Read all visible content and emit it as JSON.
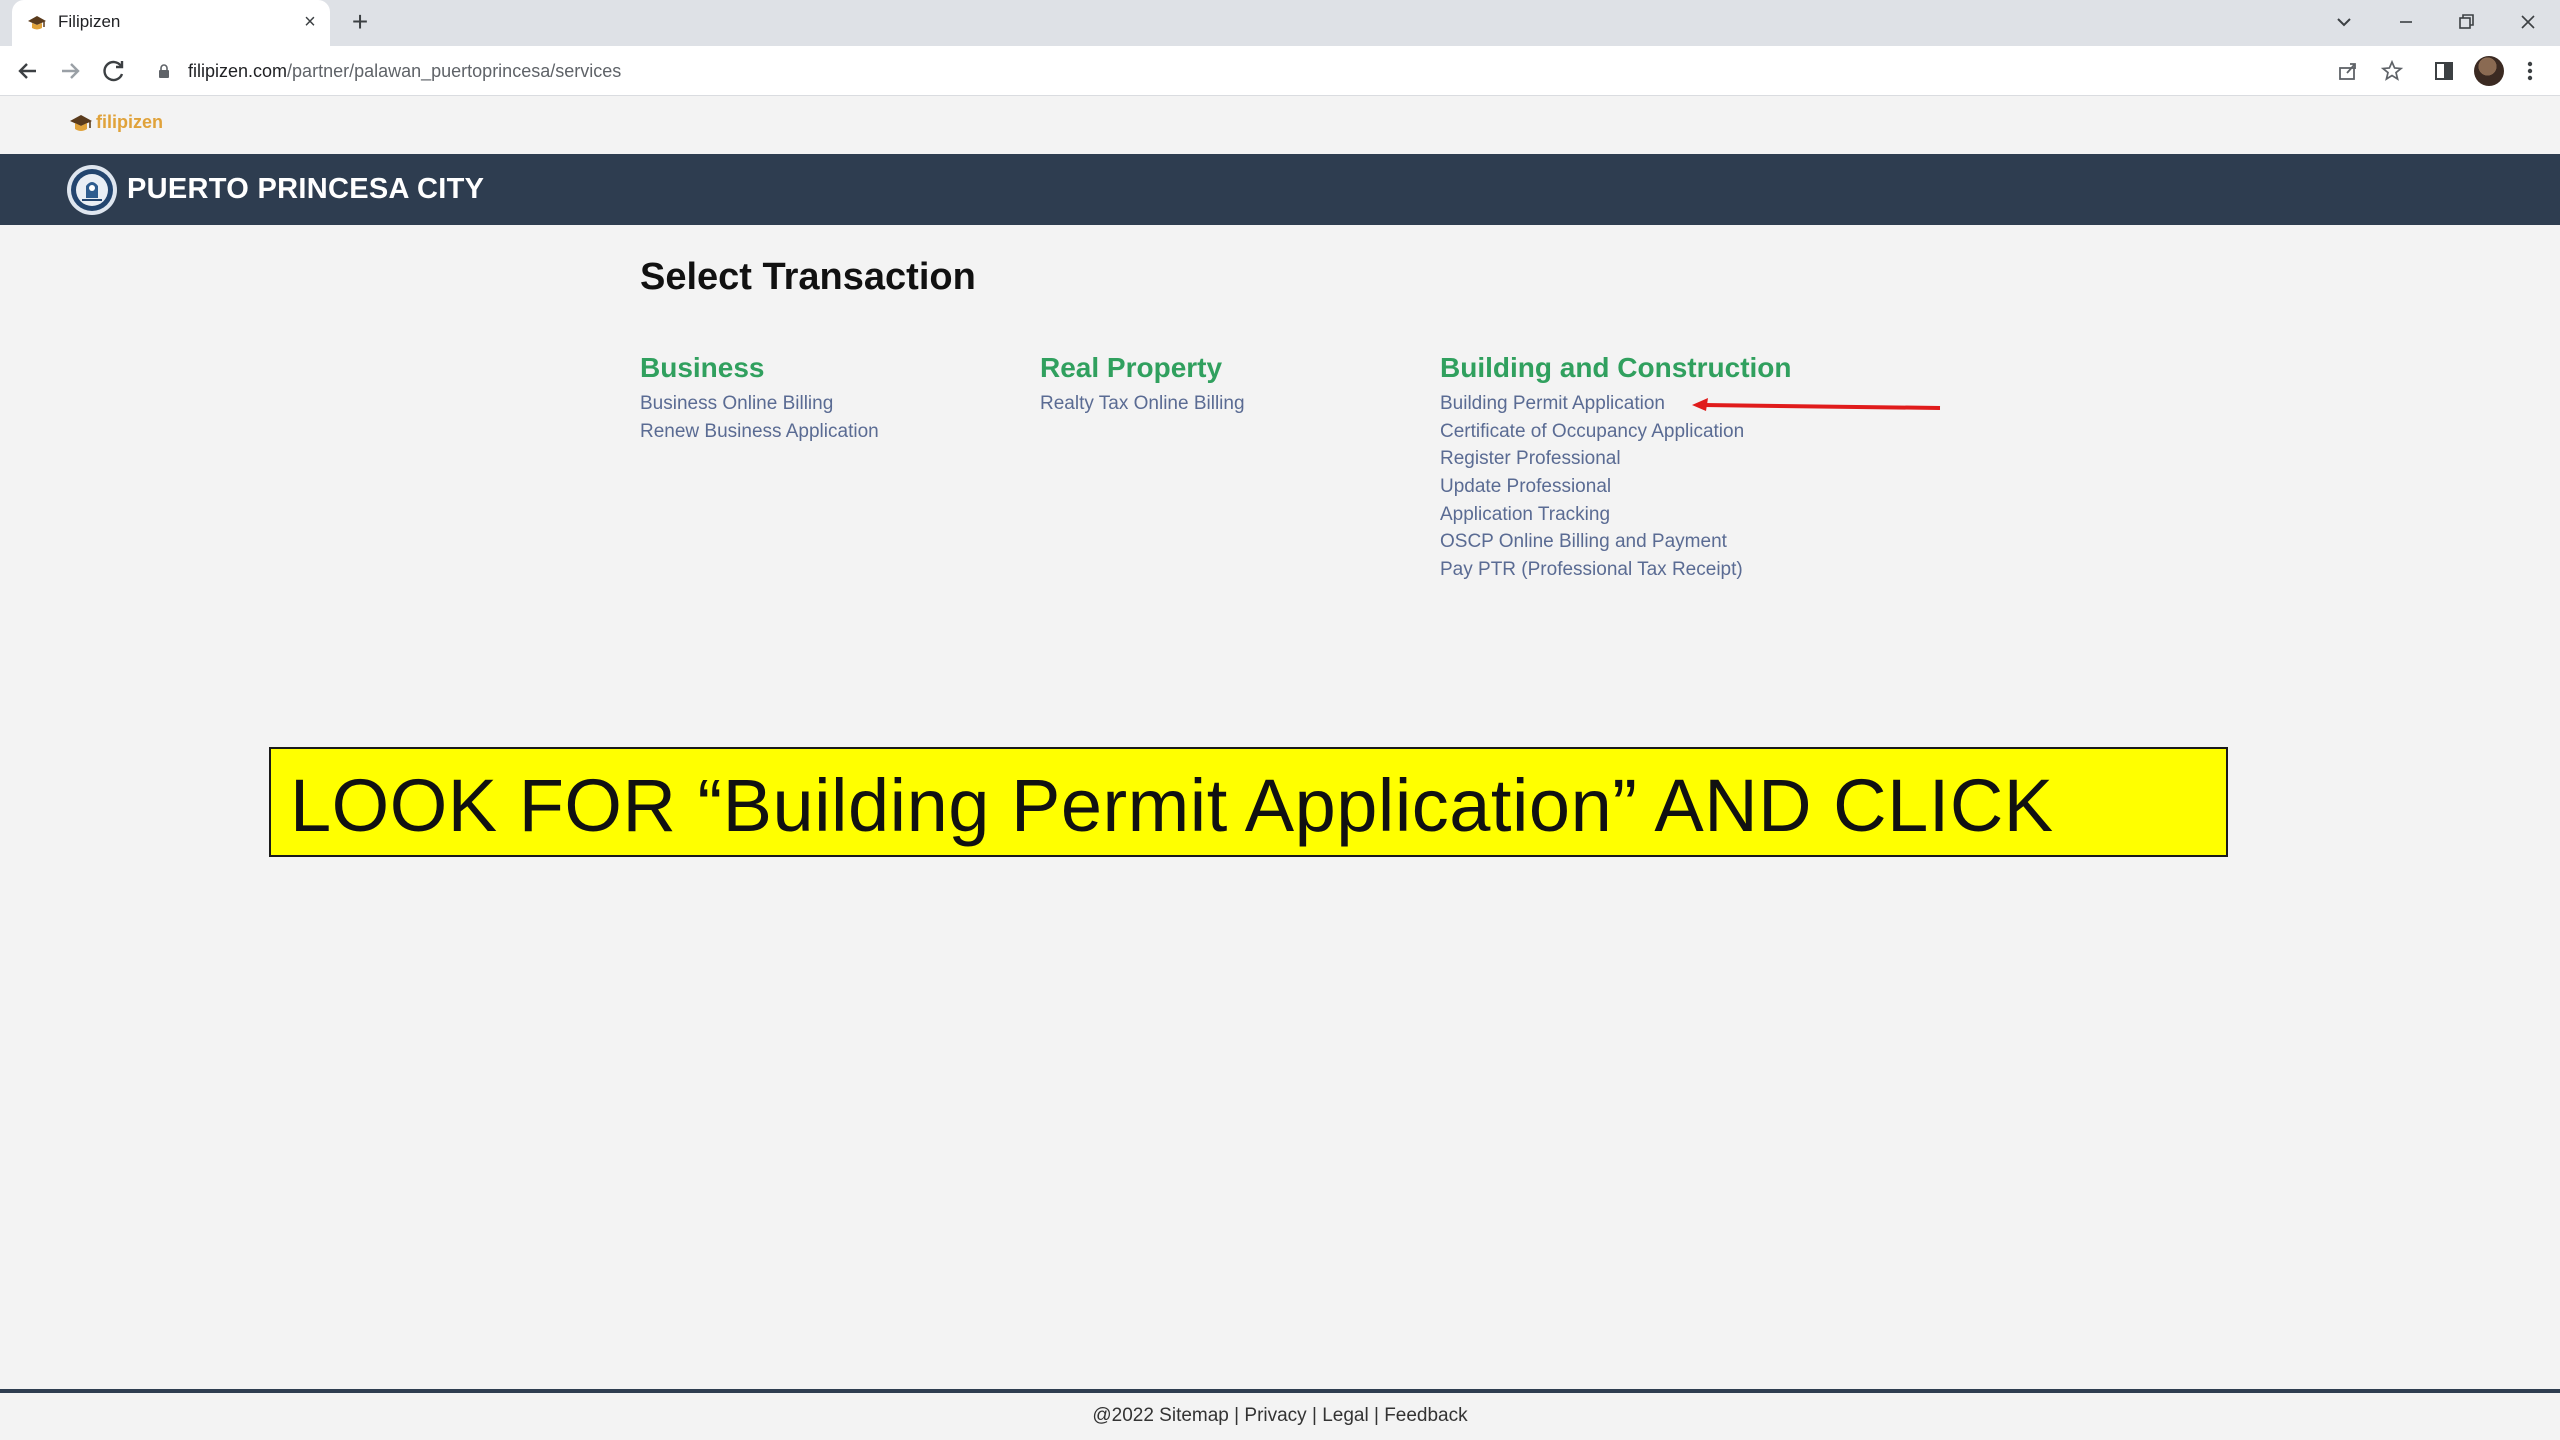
{
  "browser": {
    "tab_title": "Filipizen",
    "new_tab": "+",
    "close": "×",
    "url_host": "filipizen.com",
    "url_path": "/partner/palawan_puertoprincesa/services"
  },
  "site": {
    "brand": "filipizen",
    "city": "PUERTO PRINCESA CITY"
  },
  "main": {
    "title": "Select Transaction",
    "columns": [
      {
        "heading": "Business",
        "links": [
          "Business Online Billing",
          "Renew Business Application"
        ]
      },
      {
        "heading": "Real Property",
        "links": [
          "Realty Tax Online Billing"
        ]
      },
      {
        "heading": "Building and Construction",
        "links": [
          "Building Permit Application",
          "Certificate of Occupancy Application",
          "Register Professional",
          "Update Professional",
          "Application Tracking",
          "OSCP Online Billing and Payment",
          "Pay PTR (Professional Tax Receipt)"
        ]
      }
    ]
  },
  "annotation": {
    "text": "LOOK FOR “Building Permit Application” AND CLICK",
    "arrow_color": "#e01b1b",
    "highlight_color": "#ffff00"
  },
  "footer": {
    "copyright_sitemap": "@2022 Sitemap",
    "privacy": "Privacy",
    "legal": "Legal",
    "feedback": "Feedback",
    "separator": "|"
  },
  "colors": {
    "header_bg": "#2e3d50",
    "heading_green": "#30a05e",
    "link_blue": "#5a6b93",
    "brand_orange": "#e0a23a"
  }
}
